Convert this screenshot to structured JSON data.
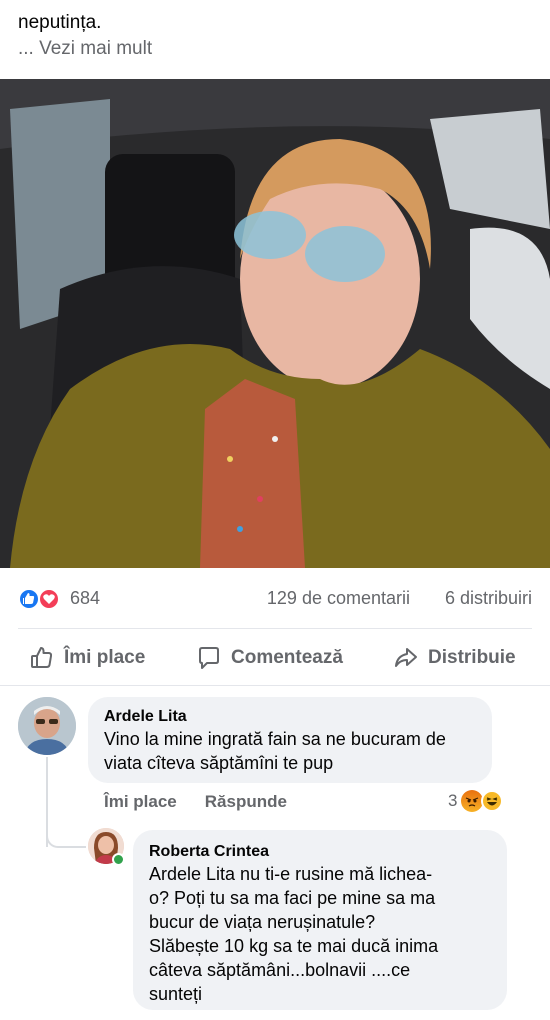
{
  "post": {
    "text": "neputința.",
    "see_more": "... Vezi mai mult"
  },
  "stats": {
    "reaction_count": "684",
    "comments": "129 de comentarii",
    "shares": "6 distribuiri"
  },
  "actions": {
    "like": "Îmi place",
    "comment": "Comentează",
    "share": "Distribuie"
  },
  "comments": [
    {
      "author": "Ardele Lita",
      "text": "Vino la mine ingrată fain sa ne bucuram de viata cîteva săptămîni te pup",
      "like_label": "Îmi place",
      "reply_label": "Răspunde",
      "reaction_count": "3"
    }
  ],
  "reply": {
    "author": "Roberta Crintea",
    "text": "Ardele Lita nu ti-e rusine mă lichea-\no? Poți tu sa ma faci pe mine sa ma\nbucur de viața nerușinatule?\nSlăbește 10 kg sa te mai ducă inima\ncâteva săptămâni...bolnavii ....ce\nsunteți"
  },
  "colors": {
    "brand_blue": "#1877f2",
    "love_red": "#f33e58",
    "secondary_text": "#65676b",
    "bubble_bg": "#f0f2f5",
    "online_green": "#31a24c"
  }
}
